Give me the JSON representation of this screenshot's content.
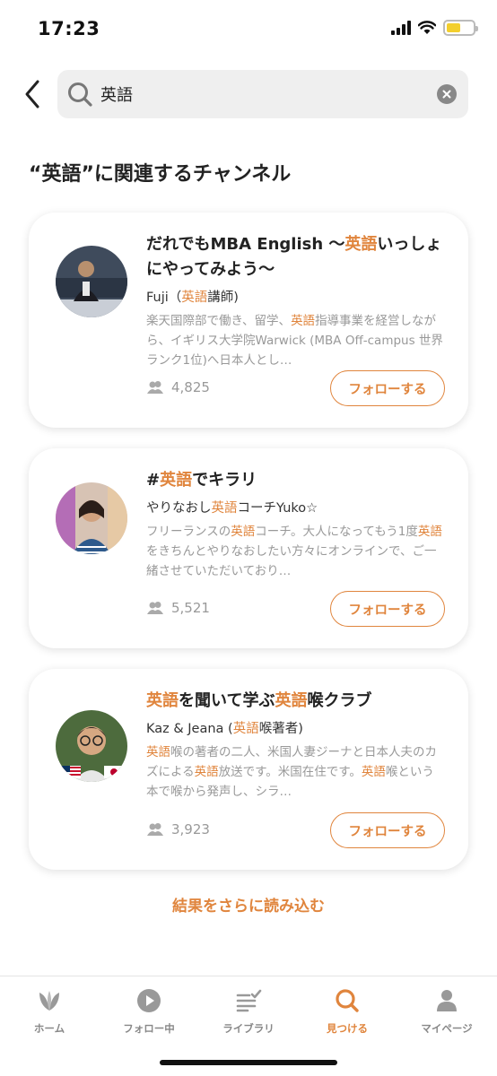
{
  "status_bar": {
    "time": "17:23"
  },
  "search": {
    "query": "英語"
  },
  "section": {
    "title": "“英語”に関連するチャンネル"
  },
  "channels": [
    {
      "title_parts": [
        "だれでもMBA English 〜",
        "英語",
        "いっしょにやってみよう〜"
      ],
      "author_parts": [
        "Fuji（",
        "英語",
        "講師)"
      ],
      "desc_parts": [
        "楽天国際部で働き、留学、",
        "英語",
        "指導事業を経営しながら、イギリス大学院Warwick (MBA Off-campus 世界ランク1位)へ日本人とし…"
      ],
      "followers": "4,825",
      "follow_label": "フォローする"
    },
    {
      "title_parts": [
        "#",
        "英語",
        "でキラリ"
      ],
      "author_parts": [
        "やりなおし",
        "英語",
        "コーチYuko☆"
      ],
      "desc_parts": [
        "フリーランスの",
        "英語",
        "コーチ。大人になってもう1度",
        "英語",
        "をきちんとやりなおしたい方々にオンラインで、ご一緒させていただいており…"
      ],
      "followers": "5,521",
      "follow_label": "フォローする"
    },
    {
      "title_parts": [
        "",
        "英語",
        "を聞いて学ぶ",
        "英語",
        "喉クラブ"
      ],
      "author_parts": [
        "Kaz & Jeana (",
        "英語",
        "喉著者)"
      ],
      "desc_parts": [
        "",
        "英語",
        "喉の著者の二人、米国人妻ジーナと日本人夫のカズによる",
        "英語",
        "放送です。米国在住です。",
        "英語",
        "喉という本で喉から発声し、シラ…"
      ],
      "followers": "3,923",
      "follow_label": "フォローする"
    }
  ],
  "load_more": "結果をさらに読み込む",
  "tabs": [
    {
      "label": "ホーム",
      "icon": "home-leaf-icon"
    },
    {
      "label": "フォロー中",
      "icon": "play-circle-icon"
    },
    {
      "label": "ライブラリ",
      "icon": "library-list-icon"
    },
    {
      "label": "見つける",
      "icon": "search-icon"
    },
    {
      "label": "マイページ",
      "icon": "person-icon"
    }
  ],
  "colors": {
    "accent": "#e0853d",
    "muted": "#999999",
    "battery": "#f3cf2e"
  }
}
